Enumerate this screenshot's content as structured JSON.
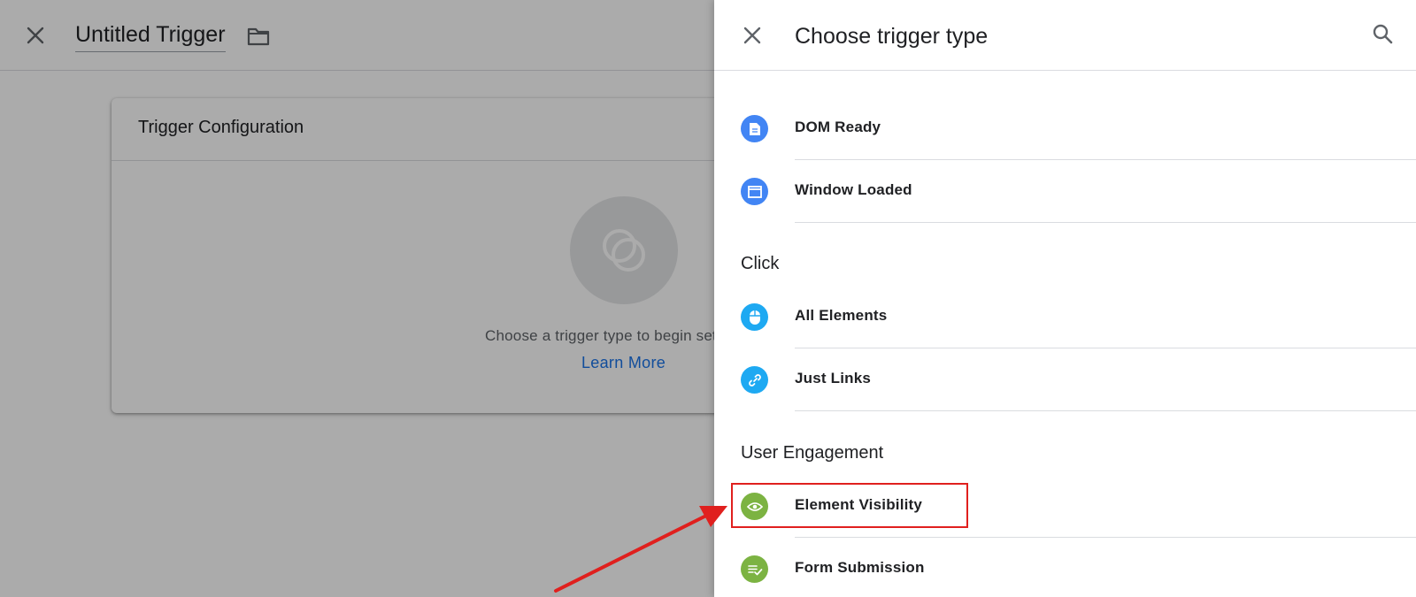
{
  "editor": {
    "title": "Untitled Trigger",
    "config_title": "Trigger Configuration",
    "empty_text": "Choose a trigger type to begin setup...",
    "learn_more": "Learn More"
  },
  "panel": {
    "title": "Choose trigger type",
    "items_pageview": [
      {
        "label": "DOM Ready",
        "icon": "document-icon",
        "color": "#4285f4"
      },
      {
        "label": "Window Loaded",
        "icon": "window-icon",
        "color": "#4285f4"
      }
    ],
    "section_click": "Click",
    "items_click": [
      {
        "label": "All Elements",
        "icon": "mouse-icon",
        "color": "#1ea9f2"
      },
      {
        "label": "Just Links",
        "icon": "link-icon",
        "color": "#1ea9f2"
      }
    ],
    "section_engagement": "User Engagement",
    "items_engagement": [
      {
        "label": "Element Visibility",
        "icon": "eye-icon",
        "color": "#7cb342"
      },
      {
        "label": "Form Submission",
        "icon": "form-check-icon",
        "color": "#7cb342"
      }
    ]
  },
  "colors": {
    "blue": "#4285f4",
    "light_blue": "#1ea9f2",
    "green": "#7cb342",
    "highlight_red": "#e0201e"
  }
}
